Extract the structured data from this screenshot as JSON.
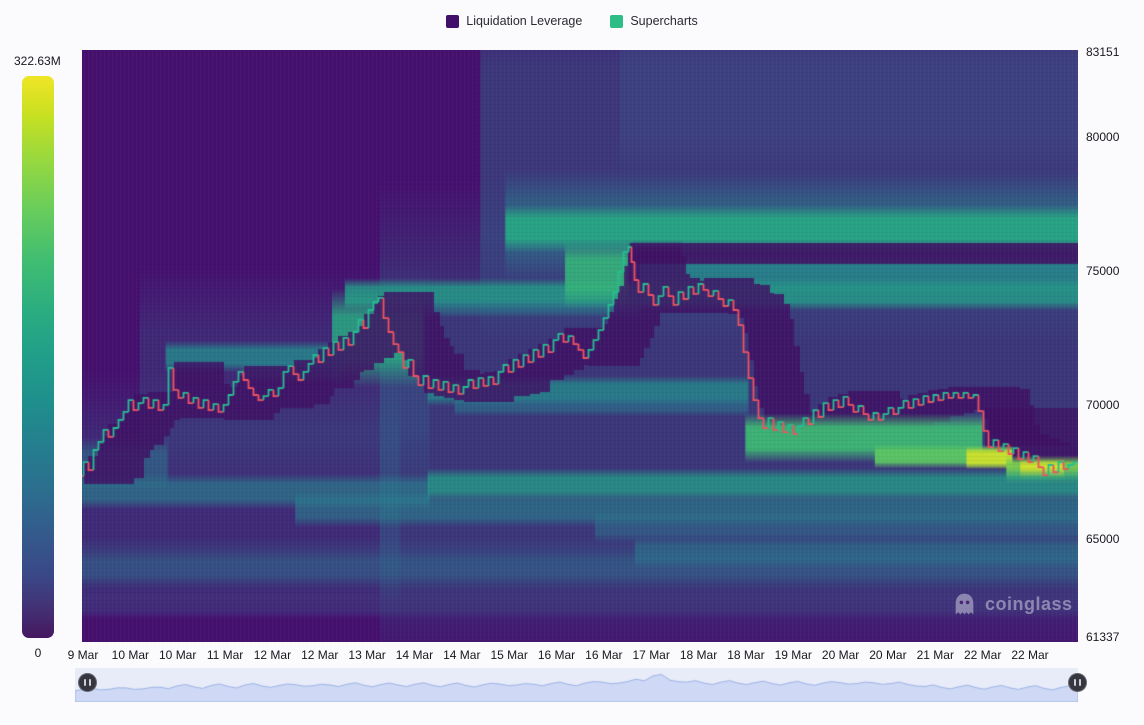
{
  "legend": {
    "items": [
      {
        "label": "Liquidation Leverage",
        "color": "#42106b"
      },
      {
        "label": "Supercharts",
        "color": "#2ebd85"
      }
    ]
  },
  "watermark": {
    "text": "coinglass"
  },
  "chart_data": {
    "type": "heatmap",
    "title": "Liquidation Leverage heatmap with BTC price overlay",
    "legend_position": "top-center",
    "grid": false,
    "y_axis": {
      "min": 61337,
      "max": 83151,
      "ticks": [
        83151,
        80000,
        75000,
        70000,
        65000,
        61337
      ]
    },
    "x_axis": {
      "tick_labels": [
        "9 Mar",
        "10 Mar",
        "10 Mar",
        "11 Mar",
        "12 Mar",
        "12 Mar",
        "13 Mar",
        "14 Mar",
        "14 Mar",
        "15 Mar",
        "16 Mar",
        "16 Mar",
        "17 Mar",
        "18 Mar",
        "18 Mar",
        "19 Mar",
        "20 Mar",
        "20 Mar",
        "21 Mar",
        "22 Mar",
        "22 Mar"
      ]
    },
    "colorbar": {
      "min_label": "0",
      "max_label": "322.63M",
      "min": 0,
      "max": 322630000,
      "colormap": "viridis",
      "low_color": "#440154",
      "high_color": "#fde725"
    },
    "price_line": {
      "up_color": "#26bd93",
      "down_color": "#ef5360",
      "points": [
        [
          78,
          67640
        ],
        [
          83,
          67340
        ],
        [
          88,
          67860
        ],
        [
          93,
          67560
        ],
        [
          98,
          68310
        ],
        [
          103,
          68610
        ],
        [
          108,
          69060
        ],
        [
          113,
          68800
        ],
        [
          118,
          69130
        ],
        [
          123,
          69430
        ],
        [
          128,
          69730
        ],
        [
          133,
          70170
        ],
        [
          138,
          69800
        ],
        [
          143,
          70060
        ],
        [
          148,
          70250
        ],
        [
          153,
          69880
        ],
        [
          158,
          70170
        ],
        [
          163,
          69800
        ],
        [
          168,
          69990
        ],
        [
          173,
          71370
        ],
        [
          178,
          70550
        ],
        [
          183,
          70250
        ],
        [
          188,
          70440
        ],
        [
          193,
          70060
        ],
        [
          198,
          70250
        ],
        [
          203,
          69880
        ],
        [
          208,
          70170
        ],
        [
          213,
          69800
        ],
        [
          218,
          70020
        ],
        [
          223,
          69730
        ],
        [
          228,
          69990
        ],
        [
          233,
          70360
        ],
        [
          238,
          70850
        ],
        [
          243,
          71220
        ],
        [
          248,
          70920
        ],
        [
          253,
          70620
        ],
        [
          258,
          70360
        ],
        [
          263,
          70170
        ],
        [
          268,
          70320
        ],
        [
          273,
          70550
        ],
        [
          278,
          70320
        ],
        [
          283,
          70620
        ],
        [
          288,
          71220
        ],
        [
          293,
          71440
        ],
        [
          298,
          71140
        ],
        [
          303,
          70920
        ],
        [
          308,
          71220
        ],
        [
          313,
          71520
        ],
        [
          318,
          71850
        ],
        [
          323,
          71590
        ],
        [
          328,
          72110
        ],
        [
          333,
          71850
        ],
        [
          338,
          72340
        ],
        [
          343,
          72040
        ],
        [
          348,
          72490
        ],
        [
          353,
          72230
        ],
        [
          358,
          72710
        ],
        [
          363,
          73160
        ],
        [
          368,
          72860
        ],
        [
          373,
          73530
        ],
        [
          378,
          73830
        ],
        [
          383,
          73980
        ],
        [
          388,
          73230
        ],
        [
          393,
          72710
        ],
        [
          398,
          72260
        ],
        [
          403,
          71960
        ],
        [
          408,
          71370
        ],
        [
          413,
          71670
        ],
        [
          418,
          71070
        ],
        [
          423,
          70730
        ],
        [
          428,
          71070
        ],
        [
          433,
          70620
        ],
        [
          438,
          70920
        ],
        [
          443,
          70550
        ],
        [
          448,
          70850
        ],
        [
          453,
          70470
        ],
        [
          458,
          70730
        ],
        [
          463,
          70400
        ],
        [
          468,
          70660
        ],
        [
          473,
          70920
        ],
        [
          478,
          70620
        ],
        [
          483,
          70990
        ],
        [
          488,
          70700
        ],
        [
          493,
          71030
        ],
        [
          498,
          70770
        ],
        [
          503,
          71220
        ],
        [
          508,
          71480
        ],
        [
          513,
          71220
        ],
        [
          518,
          71670
        ],
        [
          523,
          71410
        ],
        [
          528,
          71850
        ],
        [
          533,
          71590
        ],
        [
          538,
          72040
        ],
        [
          543,
          71780
        ],
        [
          548,
          72230
        ],
        [
          553,
          71960
        ],
        [
          558,
          72410
        ],
        [
          563,
          72640
        ],
        [
          568,
          72340
        ],
        [
          573,
          72560
        ],
        [
          578,
          72260
        ],
        [
          583,
          72040
        ],
        [
          588,
          71740
        ],
        [
          593,
          72040
        ],
        [
          598,
          72410
        ],
        [
          603,
          72780
        ],
        [
          608,
          73230
        ],
        [
          613,
          73720
        ],
        [
          618,
          74200
        ],
        [
          623,
          74950
        ],
        [
          628,
          75690
        ],
        [
          631,
          75880
        ],
        [
          634,
          75320
        ],
        [
          638,
          74650
        ],
        [
          643,
          74200
        ],
        [
          648,
          74500
        ],
        [
          653,
          74090
        ],
        [
          658,
          73720
        ],
        [
          663,
          74050
        ],
        [
          668,
          74390
        ],
        [
          673,
          74050
        ],
        [
          678,
          73720
        ],
        [
          683,
          74200
        ],
        [
          688,
          73940
        ],
        [
          693,
          74390
        ],
        [
          698,
          74130
        ],
        [
          703,
          74500
        ],
        [
          708,
          74280
        ],
        [
          713,
          74050
        ],
        [
          718,
          74240
        ],
        [
          723,
          73940
        ],
        [
          728,
          73680
        ],
        [
          733,
          73900
        ],
        [
          738,
          73530
        ],
        [
          743,
          72970
        ],
        [
          748,
          71960
        ],
        [
          753,
          70990
        ],
        [
          758,
          70170
        ],
        [
          763,
          69500
        ],
        [
          768,
          69130
        ],
        [
          773,
          69500
        ],
        [
          778,
          69060
        ],
        [
          783,
          69350
        ],
        [
          788,
          68980
        ],
        [
          793,
          69240
        ],
        [
          798,
          68910
        ],
        [
          803,
          69210
        ],
        [
          808,
          69500
        ],
        [
          813,
          69280
        ],
        [
          818,
          69800
        ],
        [
          823,
          69540
        ],
        [
          828,
          70060
        ],
        [
          833,
          69800
        ],
        [
          838,
          70170
        ],
        [
          843,
          69910
        ],
        [
          848,
          70290
        ],
        [
          853,
          69990
        ],
        [
          858,
          69730
        ],
        [
          863,
          69950
        ],
        [
          868,
          69650
        ],
        [
          873,
          69430
        ],
        [
          878,
          69690
        ],
        [
          883,
          69430
        ],
        [
          888,
          69650
        ],
        [
          893,
          69880
        ],
        [
          898,
          69650
        ],
        [
          903,
          69880
        ],
        [
          908,
          70140
        ],
        [
          913,
          69880
        ],
        [
          918,
          70210
        ],
        [
          923,
          69990
        ],
        [
          928,
          70320
        ],
        [
          933,
          70100
        ],
        [
          938,
          70360
        ],
        [
          943,
          70170
        ],
        [
          948,
          70440
        ],
        [
          953,
          70250
        ],
        [
          958,
          70440
        ],
        [
          963,
          70250
        ],
        [
          968,
          70440
        ],
        [
          973,
          70250
        ],
        [
          978,
          70360
        ],
        [
          983,
          69760
        ],
        [
          988,
          69020
        ],
        [
          993,
          68420
        ],
        [
          998,
          68680
        ],
        [
          1003,
          68270
        ],
        [
          1008,
          68530
        ],
        [
          1013,
          68160
        ],
        [
          1018,
          68380
        ],
        [
          1023,
          67970
        ],
        [
          1028,
          68230
        ],
        [
          1033,
          67860
        ],
        [
          1038,
          68080
        ],
        [
          1043,
          67670
        ],
        [
          1048,
          67370
        ],
        [
          1053,
          67750
        ],
        [
          1058,
          67480
        ],
        [
          1063,
          67860
        ],
        [
          1068,
          67600
        ],
        [
          1073,
          67750
        ],
        [
          1077,
          67860
        ]
      ]
    },
    "washes": [
      {
        "x0": 0.4,
        "x1": 1.0,
        "p0": 83151,
        "p1": 75700,
        "v": 0.34,
        "a": 0.45
      },
      {
        "x0": 0.54,
        "x1": 1.0,
        "p0": 83151,
        "p1": 79870,
        "v": 0.24,
        "a": 0.4
      },
      {
        "x0": 0.299,
        "x1": 1.0,
        "p0": 74090,
        "p1": 64390,
        "v": 0.4,
        "a": 0.38
      },
      {
        "x0": 0.0,
        "x1": 0.319,
        "p0": 69060,
        "p1": 64210,
        "v": 0.34,
        "a": 0.3
      },
      {
        "x0": 0.058,
        "x1": 0.349,
        "p0": 73160,
        "p1": 68680,
        "v": 0.33,
        "a": 0.28
      },
      {
        "x0": 0.0,
        "x1": 1.0,
        "p0": 64500,
        "p1": 63280,
        "v": 0.36,
        "a": 0.35
      }
    ],
    "liquidation_bands": [
      {
        "x0": 0.425,
        "x1": 1.0,
        "p0": 77780,
        "p1": 75620,
        "v": 0.45,
        "a": 0.45,
        "layer": "pre"
      },
      {
        "x0": 0.56,
        "x1": 1.0,
        "p0": 75250,
        "p1": 74460,
        "v": 0.5,
        "a": 0.75,
        "layer": "pre"
      },
      {
        "x0": 0.264,
        "x1": 1.0,
        "p0": 74430,
        "p1": 73790,
        "v": 0.55,
        "a": 0.85,
        "layer": "pre"
      },
      {
        "x0": 0.344,
        "x1": 0.56,
        "p0": 73790,
        "p1": 73420,
        "v": 0.45,
        "a": 0.5,
        "layer": "pre"
      },
      {
        "x0": 0.485,
        "x1": 0.548,
        "p0": 75540,
        "p1": 74200,
        "v": 0.66,
        "a": 0.9,
        "layer": "pre"
      },
      {
        "x0": 0.251,
        "x1": 0.343,
        "p0": 73460,
        "p1": 71520,
        "v": 0.62,
        "a": 0.85,
        "layer": "pre"
      },
      {
        "x0": 0.084,
        "x1": 0.264,
        "p0": 72110,
        "p1": 71480,
        "v": 0.48,
        "a": 0.8,
        "layer": "pre"
      },
      {
        "x0": 0.161,
        "x1": 0.259,
        "p0": 71480,
        "p1": 71030,
        "v": 0.42,
        "a": 0.55,
        "layer": "pre"
      },
      {
        "x0": 0.347,
        "x1": 0.669,
        "p0": 70810,
        "p1": 70210,
        "v": 0.5,
        "a": 0.75,
        "layer": "pre"
      },
      {
        "x0": 0.374,
        "x1": 0.669,
        "p0": 70210,
        "p1": 69760,
        "v": 0.42,
        "a": 0.55,
        "layer": "pre"
      },
      {
        "x0": 0.0,
        "x1": 0.086,
        "p0": 68310,
        "p1": 67270,
        "v": 0.42,
        "a": 0.5,
        "layer": "pre"
      },
      {
        "x0": 0.0,
        "x1": 0.349,
        "p0": 67120,
        "p1": 66410,
        "v": 0.44,
        "a": 0.65,
        "layer": "pre"
      },
      {
        "x0": 0.214,
        "x1": 1.0,
        "p0": 66440,
        "p1": 65740,
        "v": 0.44,
        "a": 0.6,
        "layer": "pre"
      },
      {
        "x0": 0.515,
        "x1": 1.0,
        "p0": 65770,
        "p1": 65140,
        "v": 0.4,
        "a": 0.5,
        "layer": "pre"
      },
      {
        "x0": 0.555,
        "x1": 1.0,
        "p0": 64800,
        "p1": 64170,
        "v": 0.42,
        "a": 0.55,
        "layer": "pre"
      },
      {
        "x0": 0.0,
        "x1": 1.0,
        "p0": 64210,
        "p1": 63610,
        "v": 0.35,
        "a": 0.4,
        "layer": "pre"
      },
      {
        "x0": 0.0,
        "x1": 1.0,
        "p0": 62870,
        "p1": 62270,
        "v": 0.22,
        "a": 0.45,
        "layer": "pre"
      },
      {
        "x0": 0.425,
        "x1": 1.0,
        "p0": 77040,
        "p1": 76100,
        "v": 0.6,
        "a": 0.95,
        "layer": "post"
      },
      {
        "x0": 0.666,
        "x1": 0.904,
        "p0": 69240,
        "p1": 68270,
        "v": 0.68,
        "a": 0.95,
        "layer": "post"
      },
      {
        "x0": 0.796,
        "x1": 0.934,
        "p0": 68310,
        "p1": 67830,
        "v": 0.75,
        "a": 0.95,
        "layer": "post"
      },
      {
        "x0": 0.888,
        "x1": 0.934,
        "p0": 68240,
        "p1": 67790,
        "v": 0.92,
        "a": 1.0,
        "layer": "post"
      },
      {
        "x0": 0.928,
        "x1": 1.0,
        "p0": 67860,
        "p1": 67300,
        "v": 0.8,
        "a": 0.95,
        "layer": "post"
      },
      {
        "x0": 0.942,
        "x1": 0.986,
        "p0": 67790,
        "p1": 67380,
        "v": 0.93,
        "a": 1.0,
        "layer": "post"
      },
      {
        "x0": 0.347,
        "x1": 1.0,
        "p0": 67340,
        "p1": 66700,
        "v": 0.55,
        "a": 0.8,
        "layer": "post"
      }
    ],
    "cleared_zones": [
      {
        "x0": 0.55,
        "x1": 1.0,
        "p0": 76030,
        "p1": 75250,
        "a": 0.85
      },
      {
        "x0": 0.907,
        "x1": 1.0,
        "p0": 69880,
        "p1": 68460,
        "a": 0.7
      }
    ],
    "navigator": {
      "values": [
        0.3,
        0.4,
        0.36,
        0.42,
        0.38,
        0.45,
        0.5,
        0.46,
        0.52,
        0.48,
        0.54,
        0.5,
        0.52,
        0.55,
        0.51,
        0.54,
        0.57,
        0.53,
        0.56,
        0.54,
        0.57,
        0.53,
        0.56,
        0.52,
        0.55,
        0.58,
        0.54,
        0.57,
        0.6,
        0.57,
        0.62,
        0.66,
        0.62,
        0.78,
        0.92,
        0.74,
        0.66,
        0.62,
        0.66,
        0.62,
        0.64,
        0.6,
        0.63,
        0.59,
        0.62,
        0.64,
        0.6,
        0.63,
        0.6,
        0.56,
        0.48,
        0.44,
        0.47,
        0.43,
        0.46,
        0.42,
        0.45,
        0.4,
        0.44,
        0.36
      ],
      "fill_color": "#cfd9f6",
      "line_color": "#9db4e6",
      "background": "#e8ebf8"
    }
  }
}
